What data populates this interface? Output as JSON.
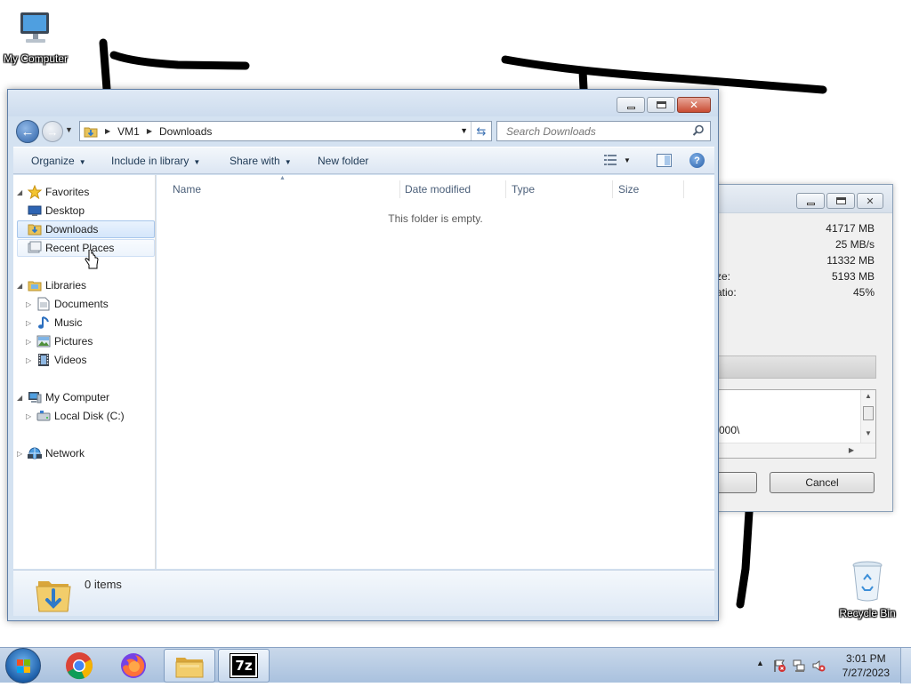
{
  "desktop": {
    "icons": [
      {
        "label": "My Computer"
      },
      {
        "label": "Recycle Bin"
      }
    ]
  },
  "zip_dialog": {
    "stats": [
      "41717 MB",
      "25 MB/s",
      "11332 MB",
      "5193 MB",
      "45%"
    ],
    "stat_labels": [
      "ze:",
      "atio:"
    ],
    "log_line": "000\\",
    "cancel_label": "Cancel"
  },
  "explorer": {
    "breadcrumb": [
      "VM1",
      "Downloads"
    ],
    "search_placeholder": "Search Downloads",
    "toolbar": {
      "organize": "Organize",
      "include_in_library": "Include in library",
      "share_with": "Share with",
      "new_folder": "New folder"
    },
    "nav": {
      "favorites": "Favorites",
      "desktop": "Desktop",
      "downloads": "Downloads",
      "recent_places": "Recent Places",
      "libraries": "Libraries",
      "documents": "Documents",
      "music": "Music",
      "pictures": "Pictures",
      "videos": "Videos",
      "my_computer": "My Computer",
      "local_disk": "Local Disk (C:)",
      "network": "Network"
    },
    "columns": [
      "Name",
      "Date modified",
      "Type",
      "Size"
    ],
    "empty_message": "This folder is empty.",
    "item_count": "0 items"
  },
  "taskbar": {
    "apps": [
      "chrome-icon",
      "firefox-icon",
      "explorer-icon",
      "7zip-icon"
    ],
    "sevenzip_label": "7z",
    "clock_time": "3:01 PM",
    "clock_date": "7/27/2023"
  }
}
